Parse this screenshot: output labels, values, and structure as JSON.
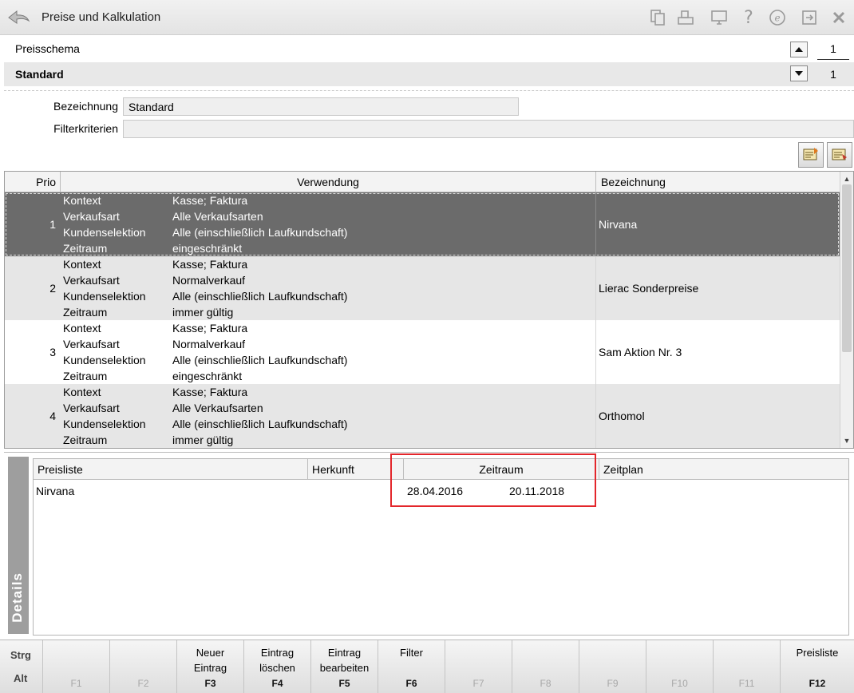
{
  "window": {
    "title": "Preise und Kalkulation"
  },
  "toolbar_icons": [
    "copy-icon",
    "print-icon",
    "monitor-icon",
    "help-icon",
    "e-icon",
    "exit-app-icon",
    "close-icon"
  ],
  "schema": {
    "label": "Preisschema",
    "name": "Standard",
    "page_top": "1",
    "page_bottom": "1"
  },
  "form": {
    "bezeichnung_label": "Bezeichnung",
    "bezeichnung_value": "Standard",
    "filter_label": "Filterkriterien",
    "filter_value": ""
  },
  "grid": {
    "headers": {
      "prio": "Prio",
      "verwendung": "Verwendung",
      "bezeichnung": "Bezeichnung"
    },
    "rows": [
      {
        "prio": "1",
        "keys": [
          "Kontext",
          "Verkaufsart",
          "Kundenselektion",
          "Zeitraum"
        ],
        "vals": [
          "Kasse; Faktura",
          "Alle Verkaufsarten",
          "Alle (einschließlich Laufkundschaft)",
          "eingeschränkt"
        ],
        "bezeichnung": "Nirvana"
      },
      {
        "prio": "2",
        "keys": [
          "Kontext",
          "Verkaufsart",
          "Kundenselektion",
          "Zeitraum"
        ],
        "vals": [
          "Kasse; Faktura",
          "Normalverkauf",
          "Alle (einschließlich Laufkundschaft)",
          "immer gültig"
        ],
        "bezeichnung": "Lierac Sonderpreise"
      },
      {
        "prio": "3",
        "keys": [
          "Kontext",
          "Verkaufsart",
          "Kundenselektion",
          "Zeitraum"
        ],
        "vals": [
          "Kasse; Faktura",
          "Normalverkauf",
          "Alle (einschließlich Laufkundschaft)",
          "eingeschränkt"
        ],
        "bezeichnung": "Sam Aktion Nr. 3"
      },
      {
        "prio": "4",
        "keys": [
          "Kontext",
          "Verkaufsart",
          "Kundenselektion",
          "Zeitraum"
        ],
        "vals": [
          "Kasse; Faktura",
          "Alle Verkaufsarten",
          "Alle (einschließlich Laufkundschaft)",
          "immer gültig"
        ],
        "bezeichnung": "Orthomol"
      }
    ]
  },
  "details": {
    "tab_label": "Details",
    "headers": {
      "preisliste": "Preisliste",
      "herkunft": "Herkunft",
      "zeitraum": "Zeitraum",
      "zeitplan": "Zeitplan"
    },
    "row": {
      "preisliste": "Nirvana",
      "herkunft": "",
      "von": "28.04.2016",
      "bis": "20.11.2018",
      "zeitplan": ""
    }
  },
  "fkeys": {
    "strg": "Strg",
    "alt": "Alt",
    "items": [
      {
        "key": "F1",
        "label": ""
      },
      {
        "key": "F2",
        "label": ""
      },
      {
        "key": "F3",
        "label": "Neuer\nEintrag"
      },
      {
        "key": "F4",
        "label": "Eintrag\nlöschen"
      },
      {
        "key": "F5",
        "label": "Eintrag\nbearbeiten"
      },
      {
        "key": "F6",
        "label": "Filter"
      },
      {
        "key": "F7",
        "label": ""
      },
      {
        "key": "F8",
        "label": ""
      },
      {
        "key": "F9",
        "label": ""
      },
      {
        "key": "F10",
        "label": ""
      },
      {
        "key": "F11",
        "label": ""
      },
      {
        "key": "F12",
        "label": "Preisliste"
      }
    ]
  }
}
